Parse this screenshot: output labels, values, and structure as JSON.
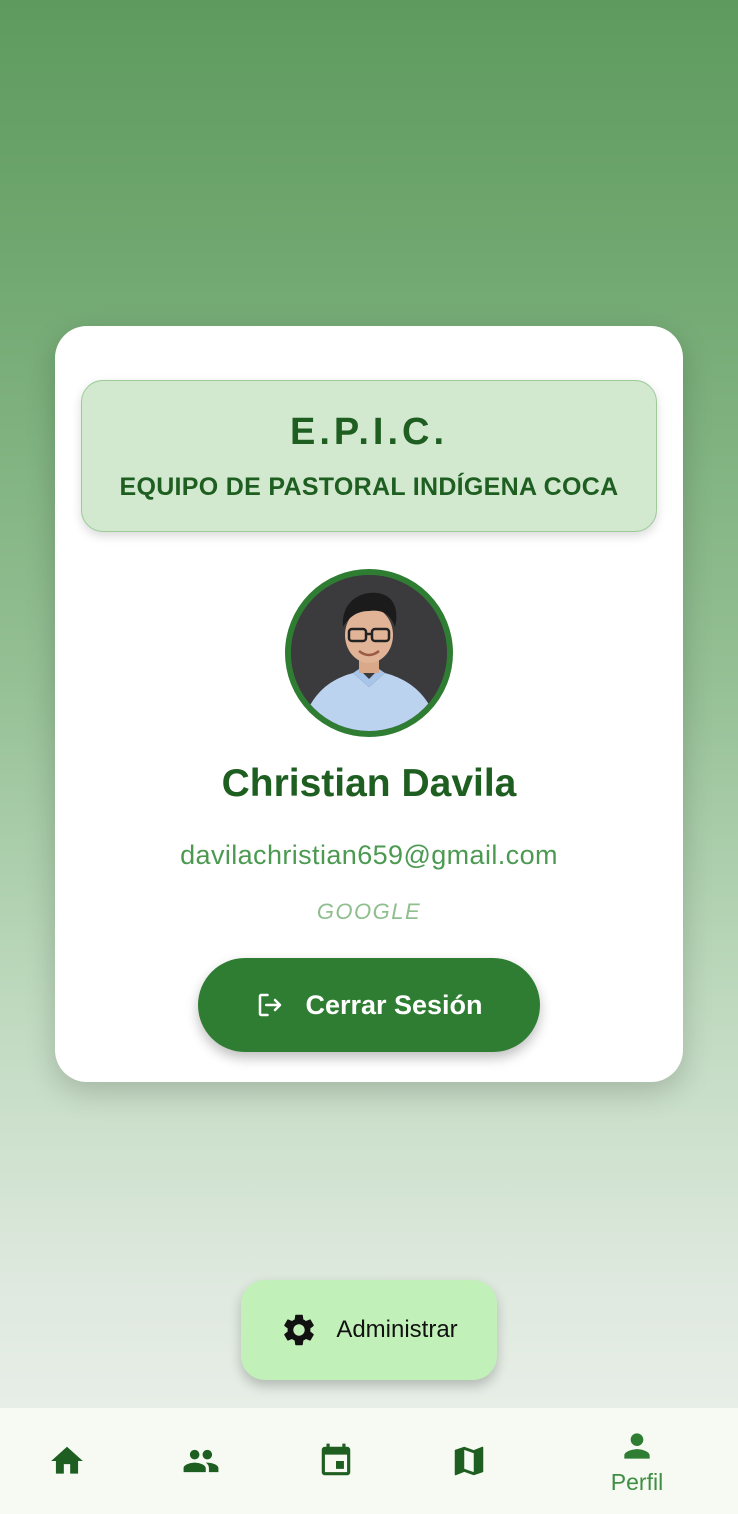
{
  "banner": {
    "title": "E.P.I.C.",
    "subtitle": "EQUIPO DE PASTORAL INDÍGENA COCA"
  },
  "profile": {
    "name": "Christian Davila",
    "email": "davilachristian659@gmail.com",
    "provider": "GOOGLE"
  },
  "actions": {
    "logout_label": "Cerrar Sesión",
    "admin_label": "Administrar"
  },
  "nav": {
    "items": [
      {
        "icon": "home-icon",
        "label": ""
      },
      {
        "icon": "people-icon",
        "label": ""
      },
      {
        "icon": "calendar-icon",
        "label": ""
      },
      {
        "icon": "map-icon",
        "label": ""
      },
      {
        "icon": "person-icon",
        "label": "Perfil",
        "active": true
      }
    ]
  },
  "colors": {
    "primary": "#2e7d32",
    "text_dark": "#1f5e21",
    "banner_bg": "#d2e8cf",
    "admin_bg": "#c2f0b9"
  }
}
